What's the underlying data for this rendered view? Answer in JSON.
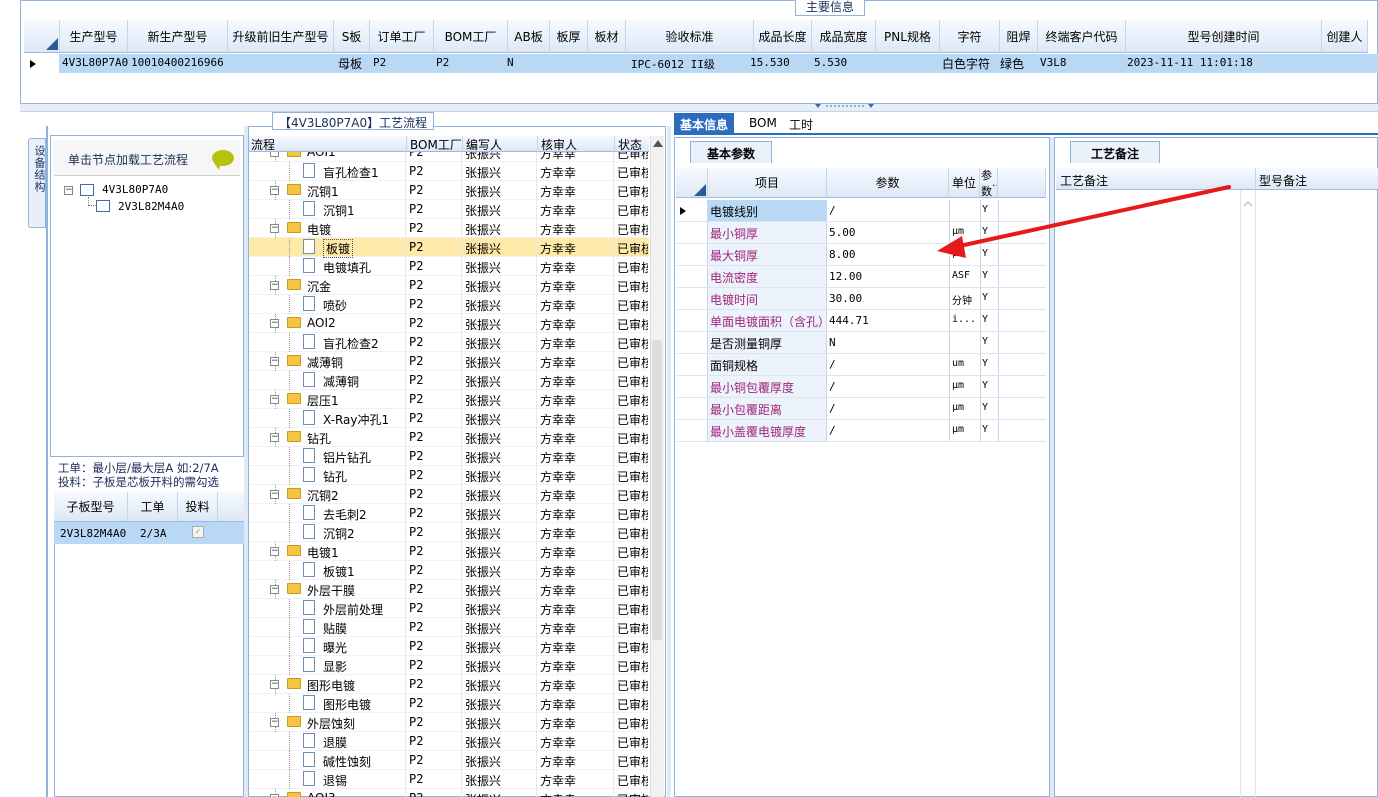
{
  "top": {
    "caption": "主要信息",
    "columns": [
      "生产型号",
      "新生产型号",
      "升级前旧生产型号",
      "S板",
      "订单工厂",
      "BOM工厂",
      "AB板",
      "板厚",
      "板材",
      "验收标准",
      "成品长度",
      "成品宽度",
      "PNL规格",
      "字符",
      "阻焊",
      "终端客户代码",
      "型号创建时间",
      "创建人"
    ],
    "row": {
      "model": "4V3L80P7A0",
      "new_model": "10010400216966",
      "s_board": "母板",
      "order_factory": "P2",
      "bom_factory": "P2",
      "ab_board": "N",
      "standard": "IPC-6012 II级",
      "length": "15.530",
      "width": "5.530",
      "char": "白色字符",
      "solder": "绿色",
      "customer": "V3L8",
      "created": "2023-11-11 11:01:18"
    }
  },
  "nav": {
    "side_tab": "设备结构",
    "header": "单击节点加载工艺流程",
    "tree_root": "4V3L80P7A0",
    "tree_child": "2V3L82M4A0",
    "hint_line1": "工单：最小层/最大层A 如:2/7A",
    "hint_line2": "投料：子板是芯板开料的需勾选",
    "sub_columns": [
      "子板型号",
      "工单",
      "投料"
    ],
    "sub_row": {
      "model": "2V3L82M4A0",
      "work": "2/3A"
    }
  },
  "process": {
    "title": "【4V3L80P7A0】工艺流程",
    "columns": [
      "流程",
      "BOM工厂",
      "编写人",
      "核审人",
      "状态"
    ],
    "rows": [
      {
        "name": "AOI1",
        "folder": true,
        "partial": true
      },
      {
        "name": "盲孔检查1",
        "folder": false
      },
      {
        "name": "沉铜1",
        "folder": true
      },
      {
        "name": "沉铜1",
        "folder": false
      },
      {
        "name": "电镀",
        "folder": true
      },
      {
        "name": "板镀",
        "folder": false,
        "selected": true
      },
      {
        "name": "电镀填孔",
        "folder": false
      },
      {
        "name": "沉金",
        "folder": true
      },
      {
        "name": "喷砂",
        "folder": false
      },
      {
        "name": "AOI2",
        "folder": true
      },
      {
        "name": "盲孔检查2",
        "folder": false
      },
      {
        "name": "减薄铜",
        "folder": true
      },
      {
        "name": "减薄铜",
        "folder": false
      },
      {
        "name": "层压1",
        "folder": true
      },
      {
        "name": "X-Ray冲孔1",
        "folder": false
      },
      {
        "name": "钻孔",
        "folder": true
      },
      {
        "name": "铝片钻孔",
        "folder": false
      },
      {
        "name": "钻孔",
        "folder": false
      },
      {
        "name": "沉铜2",
        "folder": true
      },
      {
        "name": "去毛刺2",
        "folder": false
      },
      {
        "name": "沉铜2",
        "folder": false
      },
      {
        "name": "电镀1",
        "folder": true
      },
      {
        "name": "板镀1",
        "folder": false
      },
      {
        "name": "外层干膜",
        "folder": true
      },
      {
        "name": "外层前处理",
        "folder": false
      },
      {
        "name": "贴膜",
        "folder": false
      },
      {
        "name": "曝光",
        "folder": false
      },
      {
        "name": "显影",
        "folder": false
      },
      {
        "name": "图形电镀",
        "folder": true
      },
      {
        "name": "图形电镀",
        "folder": false
      },
      {
        "name": "外层蚀刻",
        "folder": true
      },
      {
        "name": "退膜",
        "folder": false
      },
      {
        "name": "碱性蚀刻",
        "folder": false
      },
      {
        "name": "退锡",
        "folder": false
      },
      {
        "name": "AOI3",
        "folder": true,
        "partial": true
      }
    ],
    "bom": "P2",
    "writer": "张振兴",
    "reviewer": "方幸幸",
    "status": "已审核"
  },
  "right": {
    "tabs": [
      "基本信息",
      "BOM",
      "工时"
    ],
    "params_tab": "基本参数",
    "param_columns": [
      "项目",
      "参数",
      "单位",
      "参数"
    ],
    "params": [
      {
        "item": "电镀线别",
        "value": "/",
        "unit": "",
        "flag": "Y",
        "color": "#000000"
      },
      {
        "item": "最小铜厚",
        "value": "5.00",
        "unit": "μm",
        "flag": "Y",
        "color": "#a0267a"
      },
      {
        "item": "最大铜厚",
        "value": "8.00",
        "unit": "μm",
        "flag": "Y",
        "color": "#a0267a"
      },
      {
        "item": "电流密度",
        "value": "12.00",
        "unit": "ASF",
        "flag": "Y",
        "color": "#a0267a"
      },
      {
        "item": "电镀时间",
        "value": "30.00",
        "unit": "分钟",
        "flag": "Y",
        "color": "#a0267a"
      },
      {
        "item": "单面电镀面积（含孔）",
        "value": "444.71",
        "unit": "i...",
        "flag": "Y",
        "color": "#a0267a"
      },
      {
        "item": "是否测量铜厚",
        "value": "N",
        "unit": "",
        "flag": "Y",
        "color": "#000000"
      },
      {
        "item": "面铜规格",
        "value": "/",
        "unit": "um",
        "flag": "Y",
        "color": "#000000"
      },
      {
        "item": "最小铜包覆厚度",
        "value": "/",
        "unit": "μm",
        "flag": "Y",
        "color": "#a0267a"
      },
      {
        "item": "最小包覆距离",
        "value": "/",
        "unit": "μm",
        "flag": "Y",
        "color": "#a0267a"
      },
      {
        "item": "最小盖覆电镀厚度",
        "value": "/",
        "unit": "μm",
        "flag": "Y",
        "color": "#a0267a"
      }
    ],
    "remarks_tab": "工艺备注",
    "remarks_columns": [
      "工艺备注",
      "型号备注"
    ]
  },
  "colors": {
    "accent": "#2d6bbf",
    "selected_row": "#b9d8f6",
    "highlight_row": "#fde9a8",
    "arrow": "#e8191b"
  }
}
